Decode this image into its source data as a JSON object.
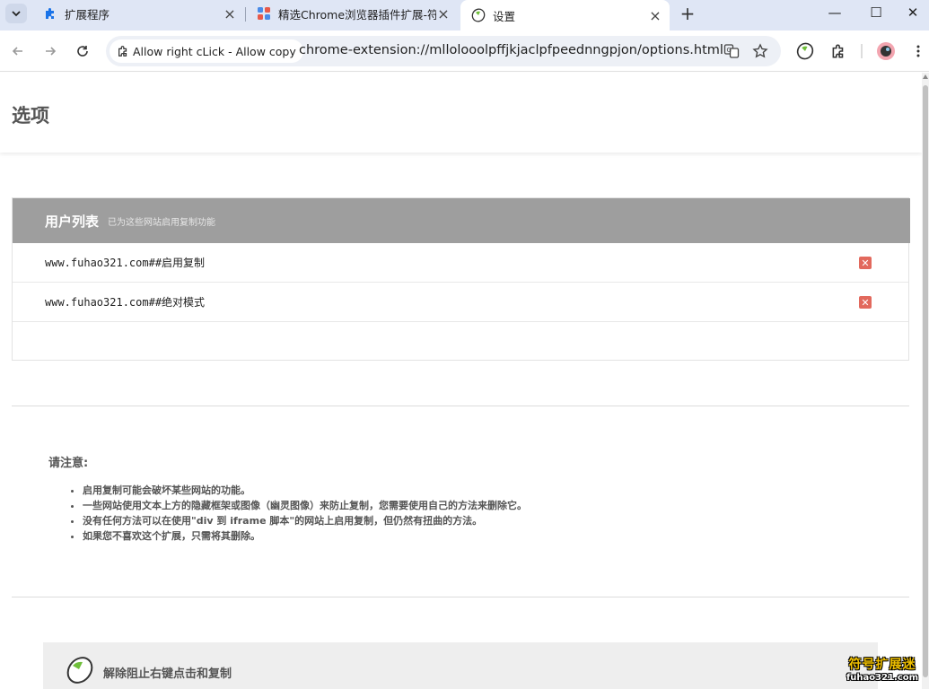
{
  "browser": {
    "tabs": [
      {
        "label": "扩展程序",
        "icon": "puzzle-icon"
      },
      {
        "label": "精选Chrome浏览器插件扩展-符",
        "icon": "store-icon"
      },
      {
        "label": "设置",
        "icon": "extension-logo-icon"
      }
    ],
    "new_tab_label": "+",
    "window_controls": {
      "minimize": "—",
      "maximize": "☐",
      "close": "✕"
    },
    "chip_label": "Allow right cLick - Allow copy",
    "url": "chrome-extension://mllolooolpffjkjaclpfpeednngpjon/options.html"
  },
  "page": {
    "title": "选项",
    "user_list": {
      "title": "用户列表",
      "subtitle": "已为这些网站启用复制功能",
      "rows": [
        {
          "text": "www.fuhao321.com##启用复制"
        },
        {
          "text": "www.fuhao321.com##绝对模式"
        }
      ],
      "delete_symbol": "✕"
    },
    "notes": {
      "title": "请注意:",
      "items": [
        "启用复制可能会破坏某些网站的功能。",
        "一些网站使用文本上方的隐藏框架或图像（幽灵图像）来防止复制，您需要使用自己的方法来删除它。",
        "没有任何方法可以在使用\"div 到 iframe 脚本\"的网站上启用复制，但仍然有扭曲的方法。",
        "如果您不喜欢这个扩展，只需将其删除。"
      ]
    },
    "footer": {
      "name": "解除阻止右键点击和复制"
    },
    "watermark": {
      "line1": "符号扩展迷",
      "line2": "fuhao321.com"
    }
  },
  "colors": {
    "accent_delete": "#e2695d",
    "list_header": "#9e9e9e",
    "tabbar": "#dfe6f5"
  }
}
